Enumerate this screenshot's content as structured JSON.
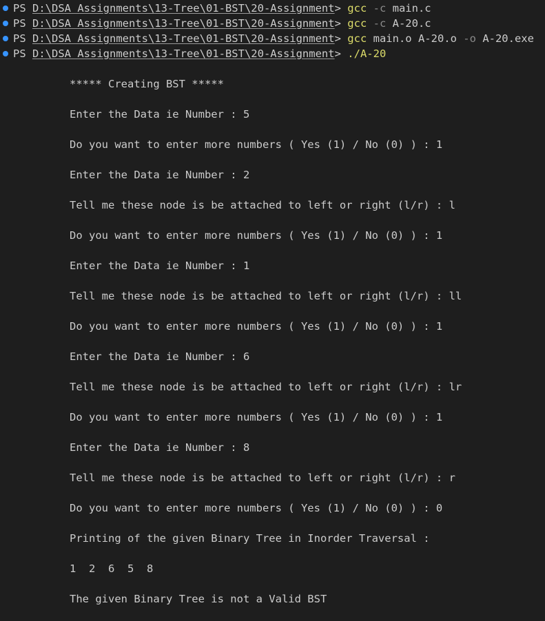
{
  "terminal": {
    "prompt": {
      "prefix": "PS ",
      "path": "D:\\DSA Assignments\\13-Tree\\01-BST\\20-Assignment",
      "suffix": "> "
    },
    "commands": [
      {
        "program": "gcc",
        "flag": "-c",
        "args": "main.c",
        "extra": "",
        "flag2": "",
        "tail": ""
      },
      {
        "program": "gcc",
        "flag": "-c",
        "args": "A-20.c",
        "extra": "",
        "flag2": "",
        "tail": ""
      },
      {
        "program": "gcc",
        "flag": "",
        "args": "main.o A-20.o",
        "extra": "",
        "flag2": "-o",
        "tail": "A-20.exe"
      },
      {
        "program": "./A-20",
        "flag": "",
        "args": "",
        "extra": "",
        "flag2": "",
        "tail": ""
      }
    ],
    "output": [
      "***** Creating BST *****",
      "Enter the Data ie Number : 5",
      "Do you want to enter more numbers ( Yes (1) / No (0) ) : 1",
      "Enter the Data ie Number : 2",
      "Tell me these node is be attached to left or right (l/r) : l",
      "Do you want to enter more numbers ( Yes (1) / No (0) ) : 1",
      "Enter the Data ie Number : 1",
      "Tell me these node is be attached to left or right (l/r) : ll",
      "Do you want to enter more numbers ( Yes (1) / No (0) ) : 1",
      "Enter the Data ie Number : 6",
      "Tell me these node is be attached to left or right (l/r) : lr",
      "Do you want to enter more numbers ( Yes (1) / No (0) ) : 1",
      "Enter the Data ie Number : 8",
      "Tell me these node is be attached to left or right (l/r) : r",
      "Do you want to enter more numbers ( Yes (1) / No (0) ) : 0",
      "Printing of the given Binary Tree in Inorder Traversal :",
      "1  2  6  5  8",
      "The given Binary Tree is not a Valid BST"
    ]
  },
  "colors": {
    "background": "#1e1e1e",
    "text": "#cccccc",
    "command": "#dcdc6a",
    "flag": "#8a8a8a",
    "decoration_dot": "#3794ff"
  }
}
